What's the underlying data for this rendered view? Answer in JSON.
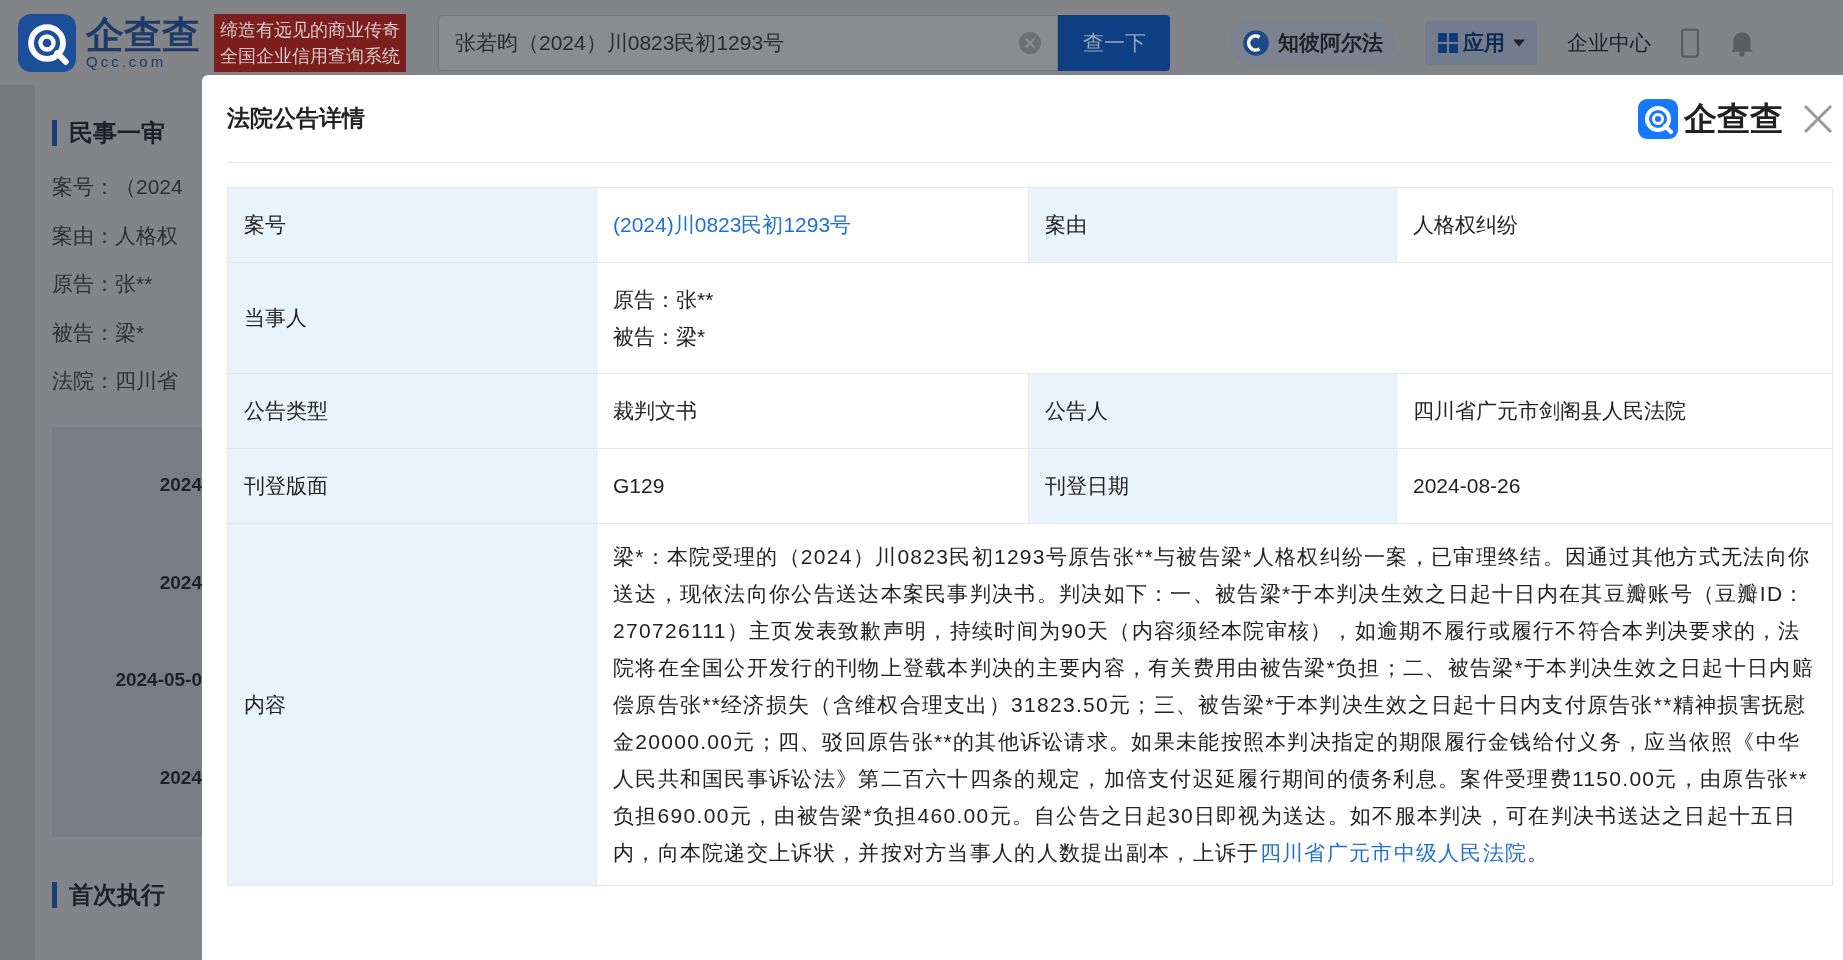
{
  "header": {
    "logo": {
      "name": "企查查",
      "domain": "Qcc.com"
    },
    "slogan": [
      "缔造有远见的商业传奇",
      "全国企业信用查询系统"
    ],
    "search": {
      "value": "张若昀（2024）川0823民初1293号",
      "button": "查一下"
    },
    "nav": [
      {
        "kind": "pill",
        "label": "知彼阿尔法"
      },
      {
        "kind": "menu",
        "label": "应用"
      },
      {
        "kind": "link",
        "label": "企业中心"
      }
    ]
  },
  "background": {
    "sections": [
      {
        "title": "民事一审",
        "fields": [
          {
            "label": "案号：",
            "value": "（2024"
          },
          {
            "label": "案由：",
            "value": "人格权"
          },
          {
            "label": "原告：",
            "value": "张**"
          },
          {
            "label": "被告：",
            "value": "梁*"
          },
          {
            "label": "法院：",
            "value": "四川省"
          }
        ],
        "timeline": [
          "2024",
          "2024",
          "2024-05-0",
          "2024"
        ]
      },
      {
        "title": "首次执行"
      }
    ]
  },
  "dialog": {
    "title": "法院公告详情",
    "brand": "企查查",
    "rows": [
      {
        "kind": "pair",
        "cells": [
          {
            "label": "案号",
            "value": "(2024)川0823民初1293号",
            "link": true
          },
          {
            "label": "案由",
            "value": "人格权纠纷",
            "link": false
          }
        ]
      },
      {
        "kind": "lines",
        "label": "当事人",
        "lines": [
          "原告：张**",
          "被告：梁*"
        ]
      },
      {
        "kind": "pair",
        "cells": [
          {
            "label": "公告类型",
            "value": "裁判文书",
            "link": false
          },
          {
            "label": "公告人",
            "value": "四川省广元市剑阁县人民法院",
            "link": false
          }
        ]
      },
      {
        "kind": "pair",
        "cells": [
          {
            "label": "刊登版面",
            "value": "G129",
            "link": false
          },
          {
            "label": "刊登日期",
            "value": "2024-08-26",
            "link": false
          }
        ]
      },
      {
        "kind": "content",
        "label": "内容",
        "text": "梁*：本院受理的（2024）川0823民初1293号原告张**与被告梁*人格权纠纷一案，已审理终结。因通过其他方式无法向你送达，现依法向你公告送达本案民事判决书。判决如下：一、被告梁*于本判决生效之日起十日内在其豆瓣账号（豆瓣ID：270726111）主页发表致歉声明，持续时间为90天（内容须经本院审核），如逾期不履行或履行不符合本判决要求的，法院将在全国公开发行的刊物上登载本判决的主要内容，有关费用由被告梁*负担；二、被告梁*于本判决生效之日起十日内赔偿原告张**经济损失（含维权合理支出）31823.50元；三、被告梁*于本判决生效之日起十日内支付原告张**精神损害抚慰金20000.00元；四、驳回原告张**的其他诉讼请求。如果未能按照本判决指定的期限履行金钱给付义务，应当依照《中华人民共和国民事诉讼法》第二百六十四条的规定，加倍支付迟延履行期间的债务利息。案件受理费1150.00元，由原告张**负担690.00元，由被告梁*负担460.00元。自公告之日起30日即视为送达。如不服本判决，可在判决书送达之日起十五日内，向本院递交上诉状，并按对方当事人的人数提出副本，上诉于",
        "link": "四川省广元市中级人民法院",
        "end": "。"
      }
    ]
  }
}
